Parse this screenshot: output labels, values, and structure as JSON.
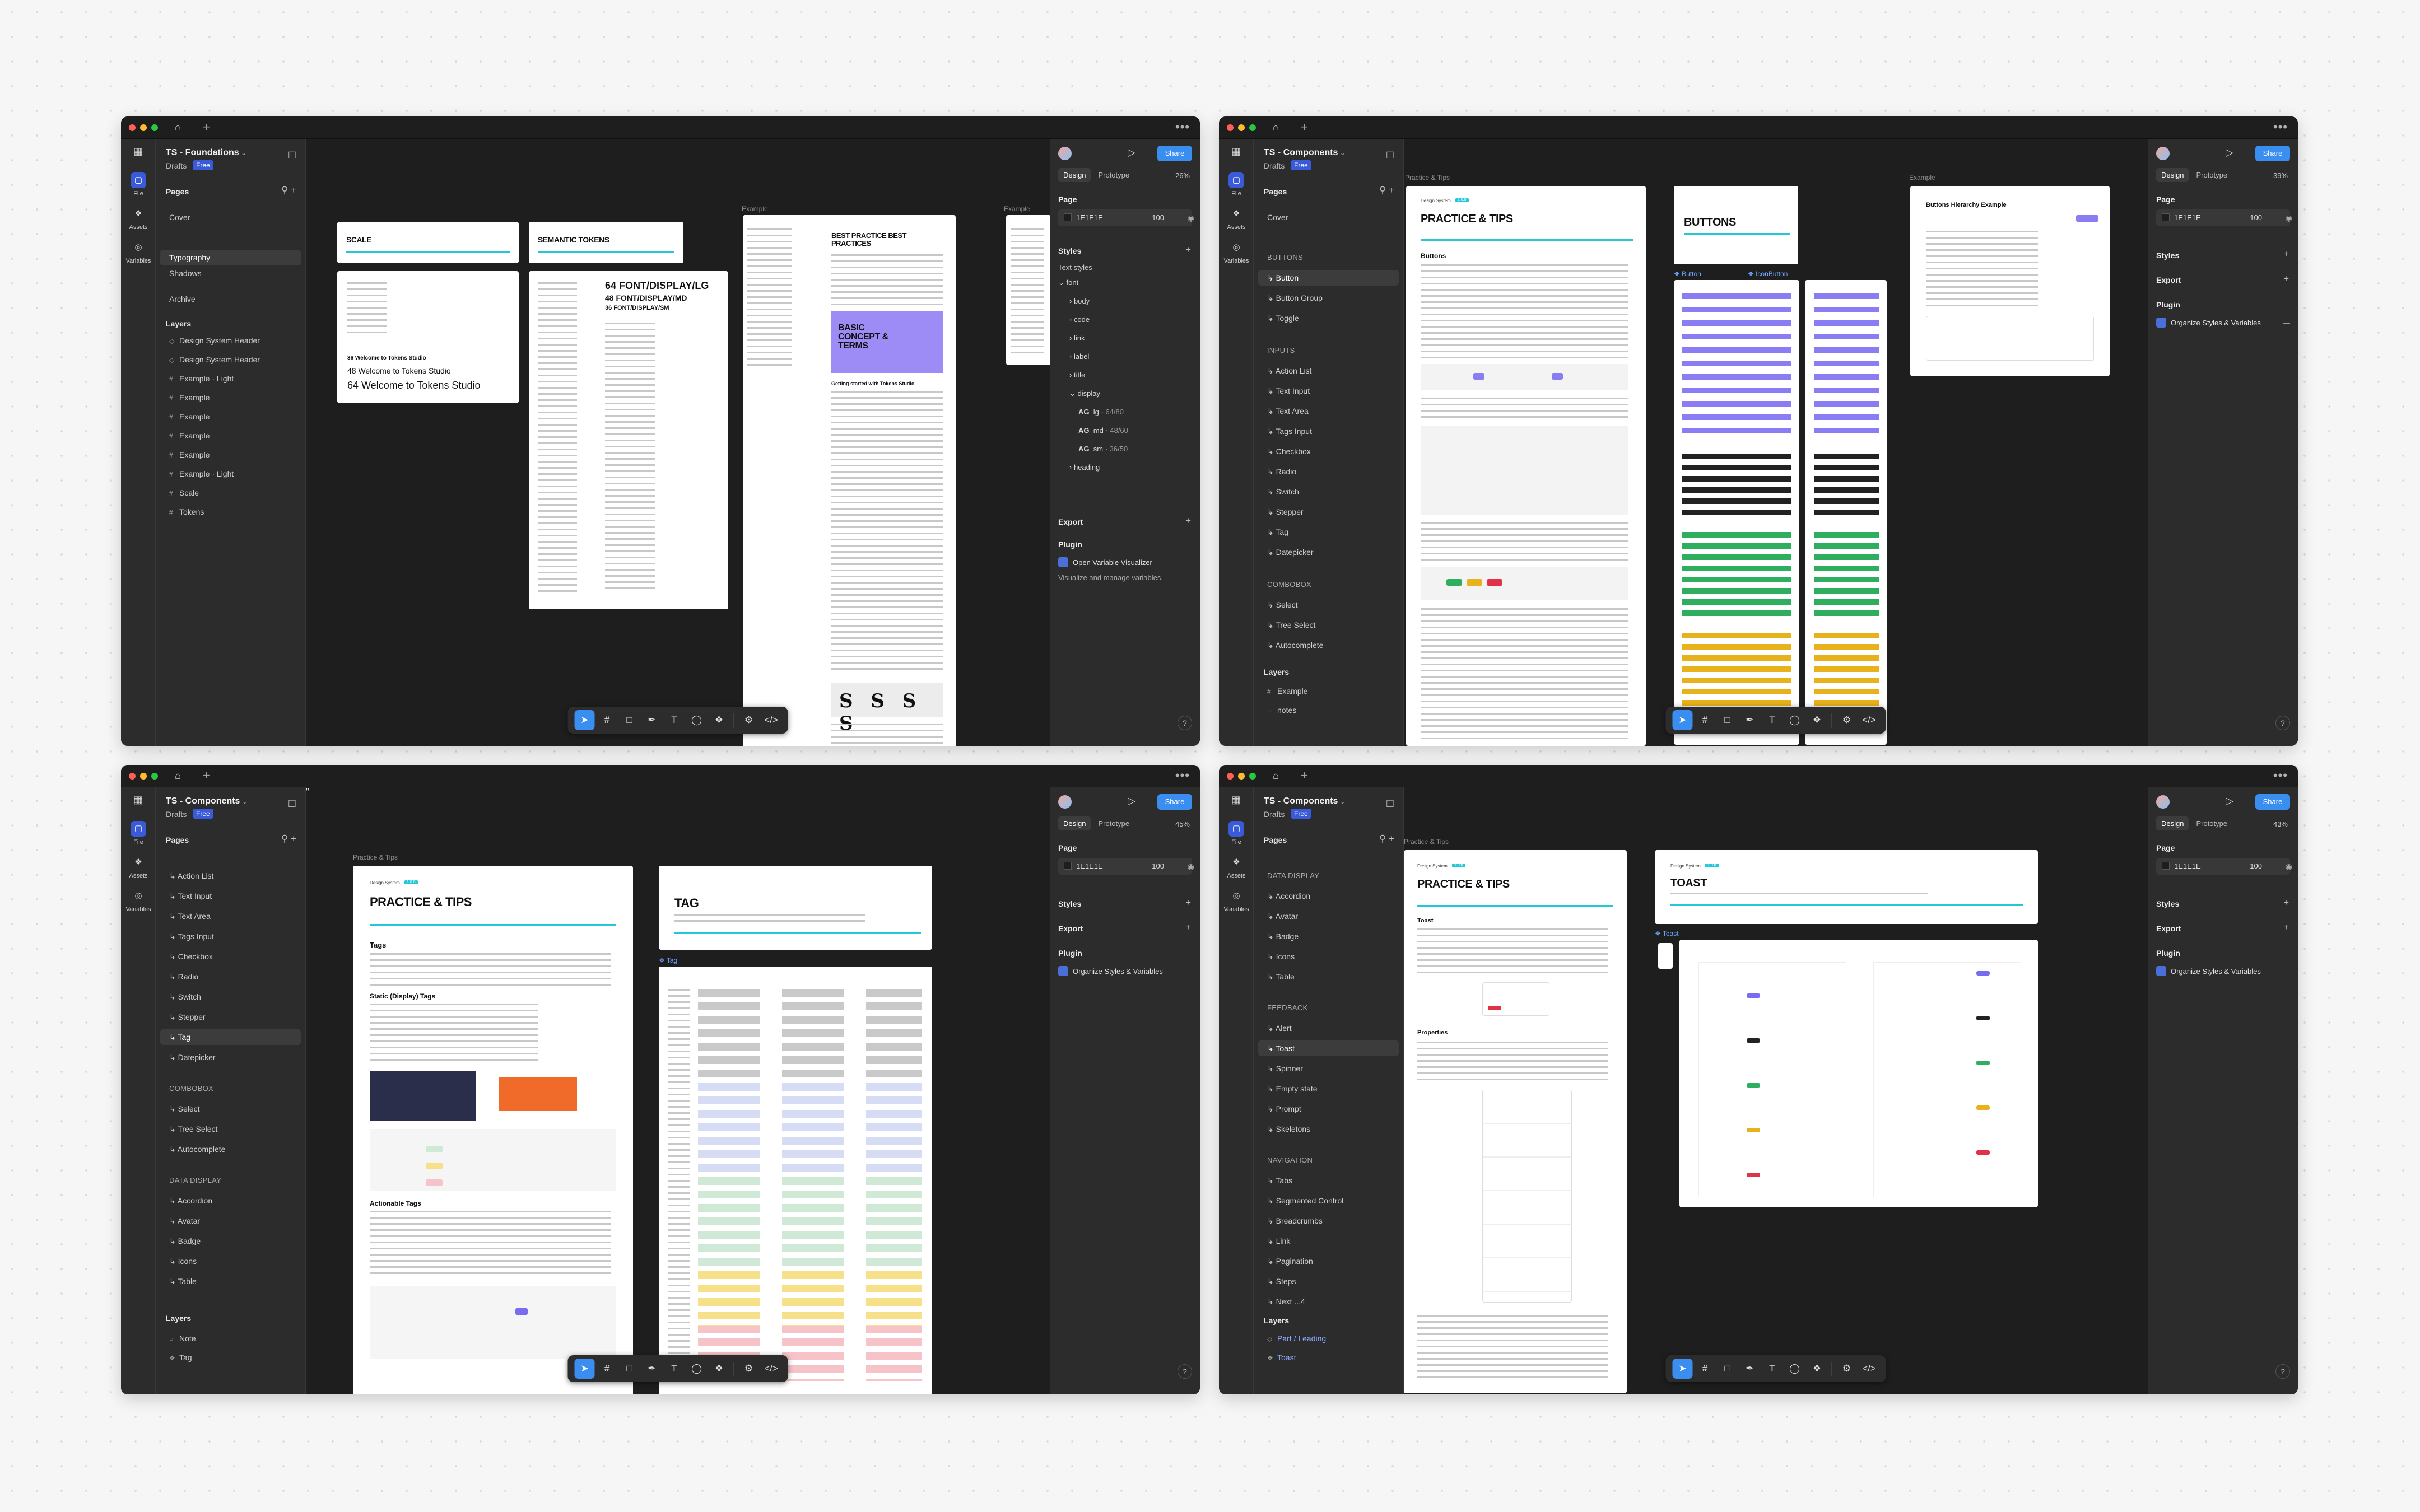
{
  "windows": [
    {
      "file": "TS - Foundations",
      "drafts": "Drafts",
      "plan": "Free",
      "zoom": "26%",
      "page_color": "1E1E1E",
      "page_opacity": "100",
      "pages": [
        "Cover",
        "Typography",
        "Shadows",
        "Archive"
      ],
      "layers": [
        "Design System Header",
        "Design System Header",
        "Example · Light",
        "Example",
        "Example",
        "Example",
        "Example",
        "Example · Light",
        "Scale",
        "Tokens"
      ],
      "canvas": {
        "label_example_1": "Example",
        "label_example_2": "Example",
        "scale_title": "SCALE",
        "semantic_title": "SEMANTIC TOKENS",
        "font_lg": "64 FONT/DISPLAY/LG",
        "font_md": "48 FONT/DISPLAY/MD",
        "font_sm": "36 FONT/DISPLAY/SM",
        "welcome_36": "36 Welcome to Tokens Studio",
        "welcome_48": "48 Welcome to Tokens Studio",
        "welcome_64": "64 Welcome to Tokens Studio",
        "bp_title": "BEST PRACTICE BEST PRACTICES",
        "basic_concept": "BASIC CONCEPT & TERMS",
        "getting_started": "Getting started with Tokens Studio",
        "ssss": "S S S S"
      },
      "styles_section": "Styles",
      "text_styles": "Text styles",
      "style_tree": [
        "font",
        "body",
        "code",
        "link",
        "label",
        "title",
        "display"
      ],
      "display_items": [
        {
          "ag": "AG",
          "name": "lg",
          "val": "64/80"
        },
        {
          "ag": "AG",
          "name": "md",
          "val": "48/60"
        },
        {
          "ag": "AG",
          "name": "sm",
          "val": "36/50"
        }
      ],
      "heading": "heading",
      "export": "Export",
      "plugin": "Plugin",
      "plugin_name": "Open Variable Visualizer",
      "plugin_desc": "Visualize and manage variables."
    },
    {
      "file": "TS - Components",
      "drafts": "Drafts",
      "plan": "Free",
      "zoom": "39%",
      "page_color": "1E1E1E",
      "page_opacity": "100",
      "pages": [
        "Cover",
        "BUTTONS",
        "Button",
        "Button Group",
        "Toggle",
        "INPUTS",
        "Action List",
        "Text Input",
        "Text Area",
        "Tags Input",
        "Checkbox",
        "Radio",
        "Switch",
        "Stepper",
        "Tag",
        "Datepicker",
        "COMBOBOX",
        "Select",
        "Tree Select",
        "Autocomplete"
      ],
      "layers": [
        "Example",
        "notes"
      ],
      "canvas": {
        "label_practice": "Practice & Tips",
        "label_example": "Example",
        "label_button": "Button",
        "label_iconbutton": "IconButton",
        "practice_title": "PRACTICE & TIPS",
        "buttons_section": "Buttons",
        "buttons_title": "BUTTONS",
        "hierarchy_title": "Buttons Hierarchy Example",
        "ds_label": "Design System",
        "ds_badge": "1.0.0"
      },
      "styles_section": "Styles",
      "export": "Export",
      "plugin": "Plugin",
      "plugin_name": "Organize Styles & Variables"
    },
    {
      "file": "TS - Components",
      "drafts": "Drafts",
      "plan": "Free",
      "zoom": "45%",
      "page_color": "1E1E1E",
      "page_opacity": "100",
      "pages": [
        "Action List",
        "Text Input",
        "Text Area",
        "Tags Input",
        "Checkbox",
        "Radio",
        "Switch",
        "Stepper",
        "Tag",
        "Datepicker",
        "COMBOBOX",
        "Select",
        "Tree Select",
        "Autocomplete",
        "DATA DISPLAY",
        "Accordion",
        "Avatar",
        "Badge",
        "Icons",
        "Table"
      ],
      "layers": [
        "Note",
        "Tag"
      ],
      "canvas": {
        "label_practice": "Practice & Tips",
        "label_tag": "Tag",
        "practice_title": "PRACTICE & TIPS",
        "tags_section": "Tags",
        "static_section": "Static (Display) Tags",
        "actionable_section": "Actionable Tags",
        "tag_title": "TAG",
        "ds_label": "Design System",
        "ds_badge": "1.0.0"
      },
      "styles_section": "Styles",
      "export": "Export",
      "plugin": "Plugin",
      "plugin_name": "Organize Styles & Variables"
    },
    {
      "file": "TS - Components",
      "drafts": "Drafts",
      "plan": "Free",
      "zoom": "43%",
      "page_color": "1E1E1E",
      "page_opacity": "100",
      "pages": [
        "DATA DISPLAY",
        "Accordion",
        "Avatar",
        "Badge",
        "Icons",
        "Table",
        "FEEDBACK",
        "Alert",
        "Toast",
        "Spinner",
        "Empty state",
        "Prompt",
        "Skeletons",
        "NAVIGATION",
        "Tabs",
        "Segmented Control",
        "Breadcrumbs",
        "Link",
        "Pagination",
        "Steps",
        "Next ...4"
      ],
      "layers": [
        "Part / Leading",
        "Toast"
      ],
      "canvas": {
        "label_practice": "Practice & Tips",
        "label_toast": "Toast",
        "practice_title": "PRACTICE & TIPS",
        "toast_section": "Toast",
        "properties_section": "Properties",
        "toast_title": "TOAST",
        "ds_label": "Design System",
        "ds_badge": "1.0.0"
      },
      "styles_section": "Styles",
      "export": "Export",
      "plugin": "Plugin",
      "plugin_name": "Organize Styles & Variables"
    }
  ],
  "common": {
    "rail": [
      "File",
      "Assets",
      "Variables"
    ],
    "pages_label": "Pages",
    "layers_label": "Layers",
    "design_tab": "Design",
    "prototype_tab": "Prototype",
    "page_label": "Page",
    "share": "Share",
    "help": "?",
    "percent": "%",
    "home": "⌂",
    "plus": "+",
    "more": "•••"
  },
  "colors": {
    "accent": "#3a5bd9",
    "share": "#3a8ef0",
    "cyan": "#22c8d8",
    "purple": "#7a6cf0",
    "canvas": "#1e1e1e"
  }
}
